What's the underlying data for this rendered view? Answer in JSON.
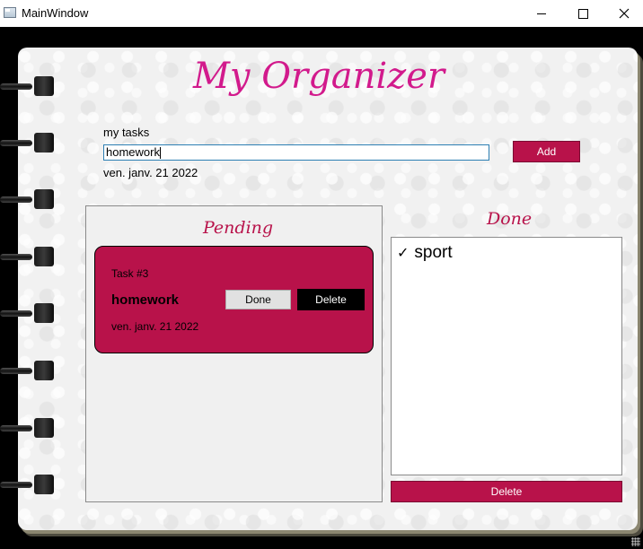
{
  "window": {
    "title": "MainWindow",
    "controls": [
      "minimize-icon",
      "maximize-icon",
      "close-icon"
    ]
  },
  "app": {
    "title": "My Organizer"
  },
  "input": {
    "label": "my tasks",
    "value": "homework",
    "add_label": "Add",
    "date": "ven. janv. 21 2022"
  },
  "pending": {
    "title": "Pending",
    "tasks": [
      {
        "number": "Task #3",
        "name": "homework",
        "done_label": "Done",
        "delete_label": "Delete",
        "date": "ven. janv. 21 2022"
      }
    ]
  },
  "done": {
    "title": "Done",
    "items": [
      {
        "icon": "check-icon",
        "label": "sport"
      }
    ],
    "delete_label": "Delete"
  },
  "colors": {
    "accent": "#b8124a",
    "title": "#d21a8c",
    "input_border": "#2d7fb3"
  }
}
